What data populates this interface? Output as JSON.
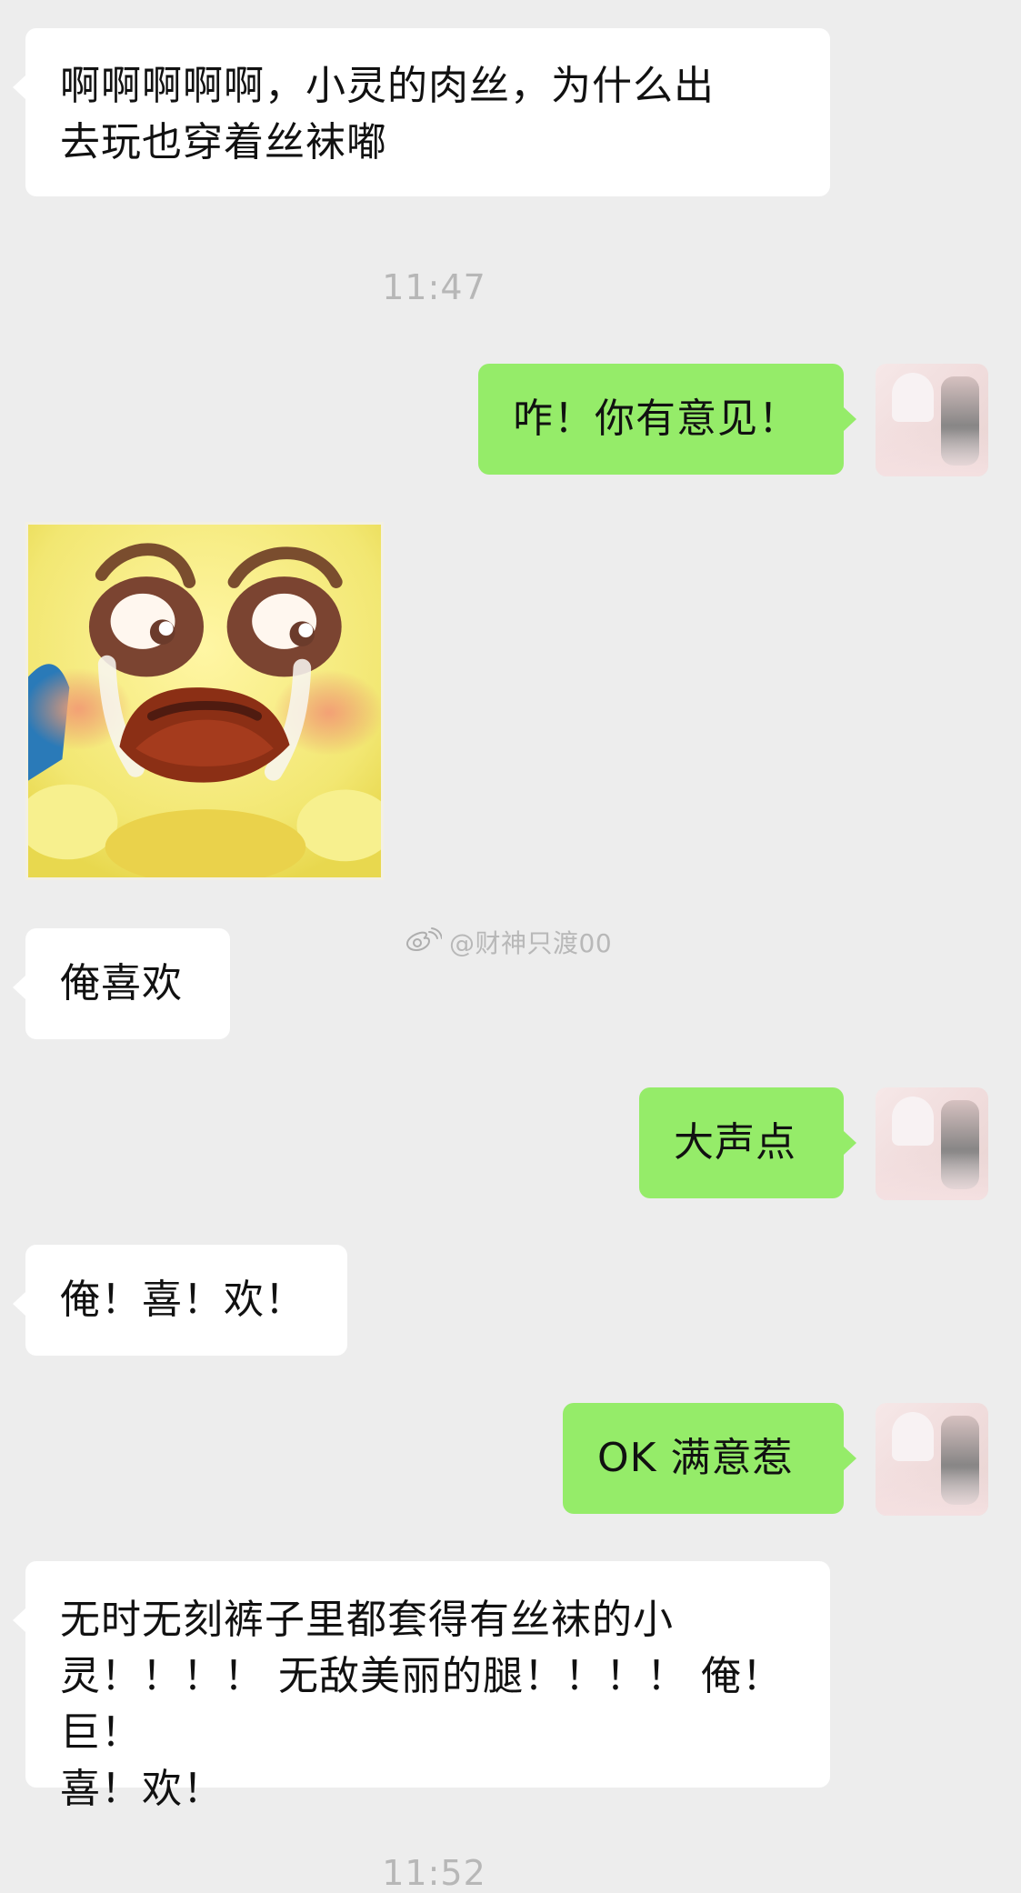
{
  "messages": {
    "m1": "啊啊啊啊啊，小灵的肉丝，为什么出\n去玩也穿着丝袜嘟",
    "t1": "11:47",
    "m2": "咋！你有意见！",
    "m3": "俺喜欢",
    "m4": "大声点",
    "m5": "俺！喜！欢！",
    "m6": "OK 满意惹",
    "m7": "无时无刻裤子里都套得有丝袜的小\n灵！！！！ 无敌美丽的腿！！！！ 俺！巨！\n喜！欢！",
    "t2": "11:52"
  },
  "watermark": {
    "text": "@财神只渡00"
  },
  "icons": {
    "sticker": "crying-face-sticker",
    "avatar": "user-avatar",
    "watermark_logo": "weibo-icon"
  },
  "colors": {
    "background": "#ededed",
    "incoming_bubble": "#ffffff",
    "outgoing_bubble": "#95ec69",
    "timestamp": "#b7b7b7"
  }
}
